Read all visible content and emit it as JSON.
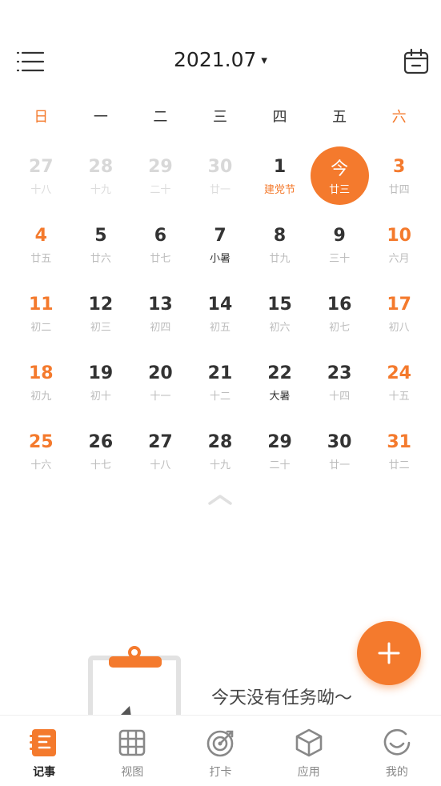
{
  "header": {
    "title": "2021.07",
    "caret": "▾",
    "menu_icon": "menu-list-icon",
    "calendar_icon": "calendar-icon"
  },
  "weekdays": [
    "日",
    "一",
    "二",
    "三",
    "四",
    "五",
    "六"
  ],
  "weeks": [
    [
      {
        "day": "27",
        "lunar": "十八",
        "style": "fade"
      },
      {
        "day": "28",
        "lunar": "十九",
        "style": "fade"
      },
      {
        "day": "29",
        "lunar": "二十",
        "style": "fade"
      },
      {
        "day": "30",
        "lunar": "廿一",
        "style": "fade"
      },
      {
        "day": "1",
        "lunar": "建党节",
        "style": "fest"
      },
      {
        "day": "今",
        "lunar": "廿三",
        "style": "today"
      },
      {
        "day": "3",
        "lunar": "廿四",
        "style": "we"
      }
    ],
    [
      {
        "day": "4",
        "lunar": "廿五",
        "style": "we"
      },
      {
        "day": "5",
        "lunar": "廿六",
        "style": ""
      },
      {
        "day": "6",
        "lunar": "廿七",
        "style": ""
      },
      {
        "day": "7",
        "lunar": "小暑",
        "style": "term"
      },
      {
        "day": "8",
        "lunar": "廿九",
        "style": ""
      },
      {
        "day": "9",
        "lunar": "三十",
        "style": ""
      },
      {
        "day": "10",
        "lunar": "六月",
        "style": "we"
      }
    ],
    [
      {
        "day": "11",
        "lunar": "初二",
        "style": "we"
      },
      {
        "day": "12",
        "lunar": "初三",
        "style": ""
      },
      {
        "day": "13",
        "lunar": "初四",
        "style": ""
      },
      {
        "day": "14",
        "lunar": "初五",
        "style": ""
      },
      {
        "day": "15",
        "lunar": "初六",
        "style": ""
      },
      {
        "day": "16",
        "lunar": "初七",
        "style": ""
      },
      {
        "day": "17",
        "lunar": "初八",
        "style": "we"
      }
    ],
    [
      {
        "day": "18",
        "lunar": "初九",
        "style": "we"
      },
      {
        "day": "19",
        "lunar": "初十",
        "style": ""
      },
      {
        "day": "20",
        "lunar": "十一",
        "style": ""
      },
      {
        "day": "21",
        "lunar": "十二",
        "style": ""
      },
      {
        "day": "22",
        "lunar": "大暑",
        "style": "term"
      },
      {
        "day": "23",
        "lunar": "十四",
        "style": ""
      },
      {
        "day": "24",
        "lunar": "十五",
        "style": "we"
      }
    ],
    [
      {
        "day": "25",
        "lunar": "十六",
        "style": "we"
      },
      {
        "day": "26",
        "lunar": "十七",
        "style": ""
      },
      {
        "day": "27",
        "lunar": "十八",
        "style": ""
      },
      {
        "day": "28",
        "lunar": "十九",
        "style": ""
      },
      {
        "day": "29",
        "lunar": "二十",
        "style": ""
      },
      {
        "day": "30",
        "lunar": "廿一",
        "style": ""
      },
      {
        "day": "31",
        "lunar": "廿二",
        "style": "we"
      }
    ]
  ],
  "empty_state": {
    "message": "今天没有任务呦～",
    "illustration": "clipboard-icon"
  },
  "fab_icon": "plus-icon",
  "tabs": [
    {
      "label": "记事",
      "icon": "notes-icon",
      "active": true
    },
    {
      "label": "视图",
      "icon": "grid-view-icon",
      "active": false
    },
    {
      "label": "打卡",
      "icon": "target-icon",
      "active": false
    },
    {
      "label": "应用",
      "icon": "cube-icon",
      "active": false
    },
    {
      "label": "我的",
      "icon": "smile-icon",
      "active": false
    }
  ],
  "colors": {
    "accent": "#f47a2d",
    "text": "#333333",
    "muted": "#bcbcbc",
    "faded": "#d8d8d8"
  }
}
